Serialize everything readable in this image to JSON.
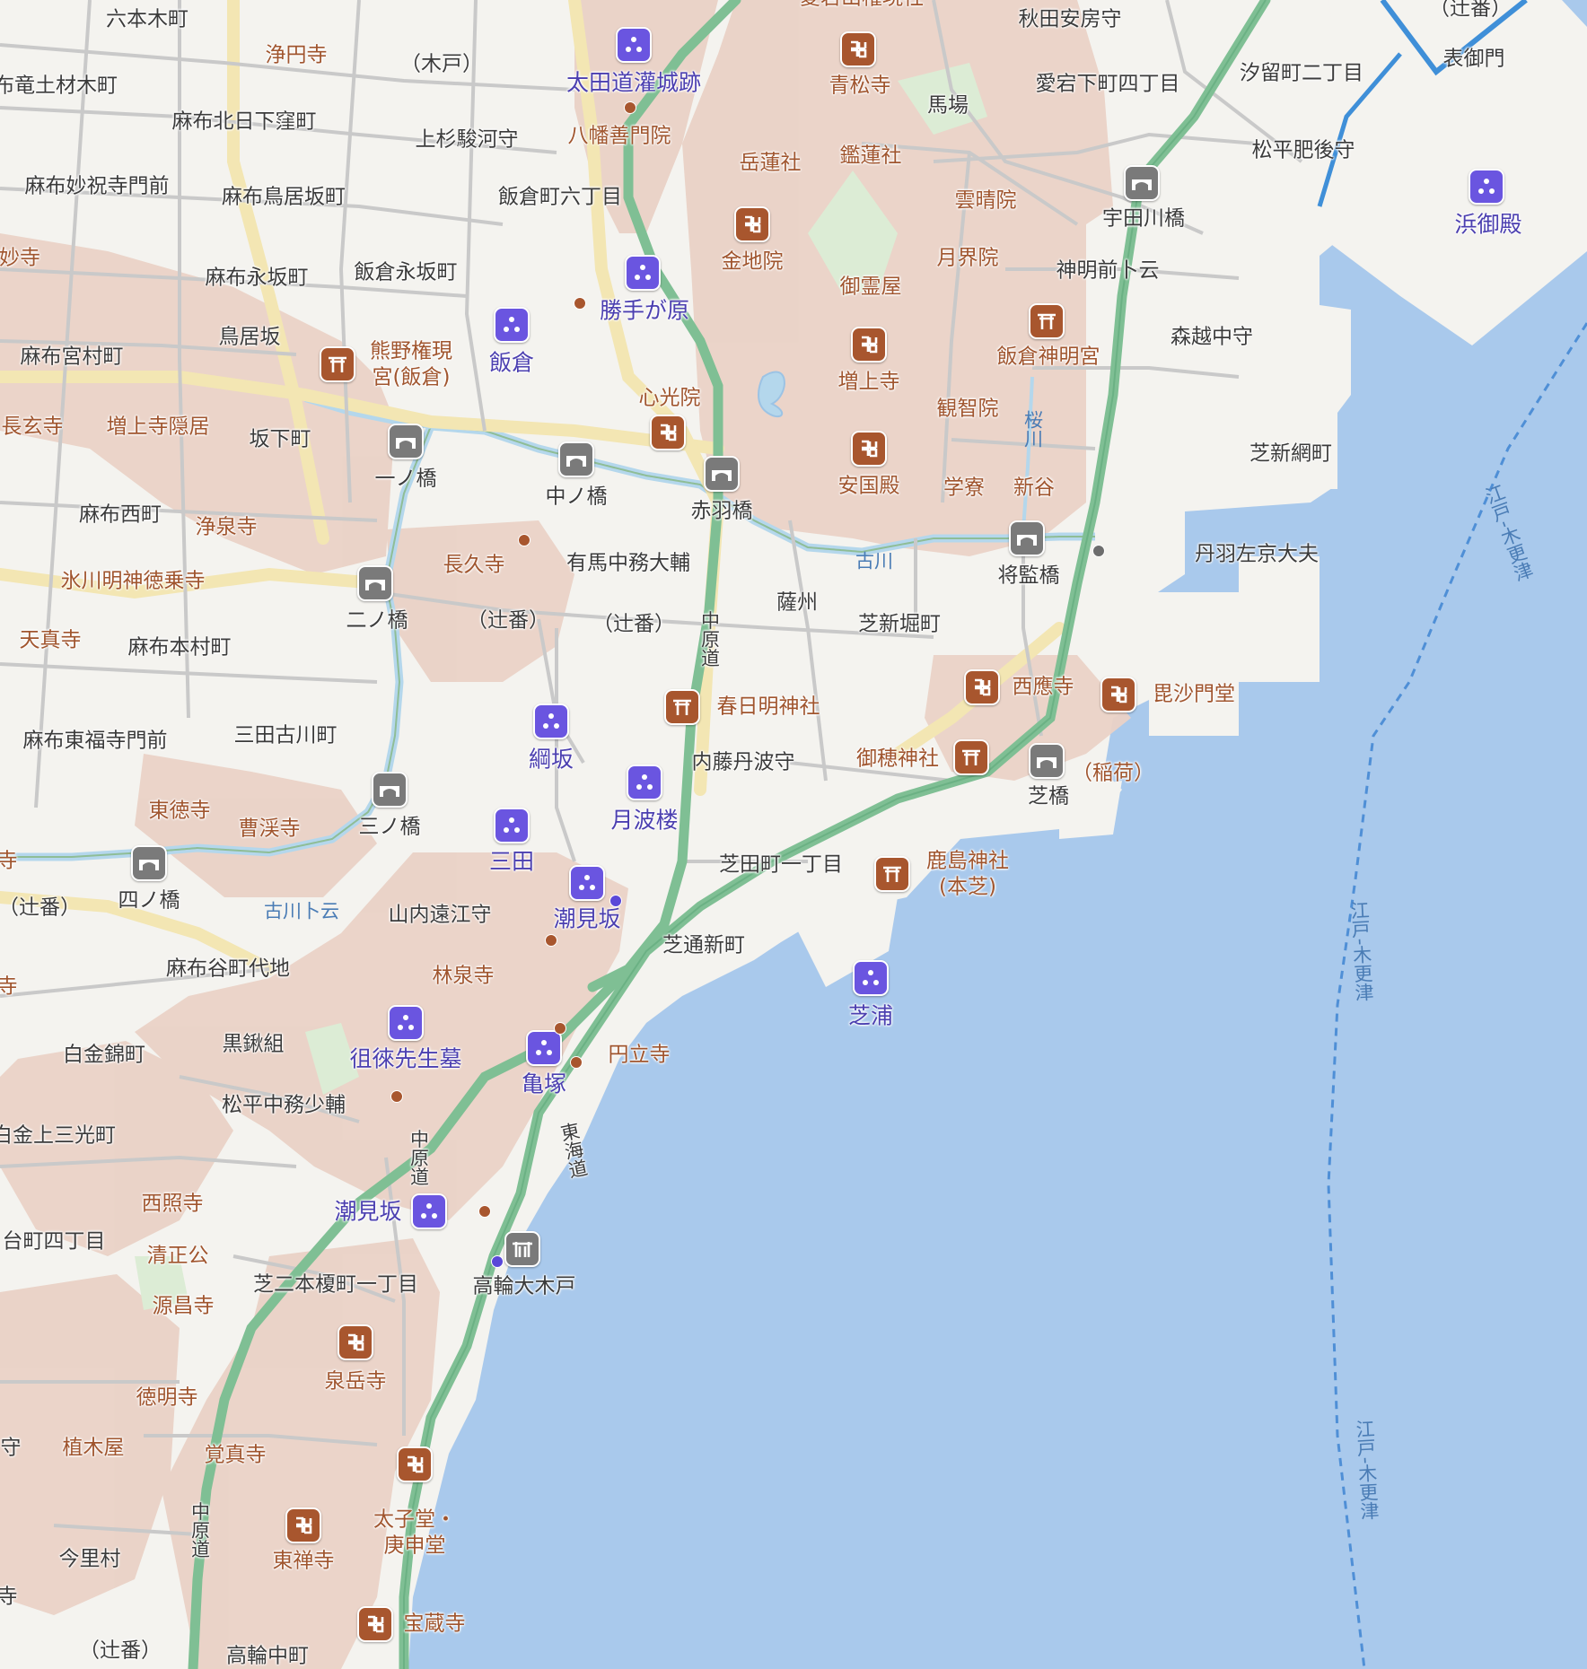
{
  "map": {
    "land_color": "#f4f3ef",
    "water_color": "#a9c9ec",
    "district_color": "#ead2c6",
    "road_color": "#f3e6b3",
    "highway_color": "#7fbf94",
    "river_color": "#b4d7ec",
    "park_color": "#dcecd5"
  },
  "icons": [
    {
      "name": "temple-icon-seishoji",
      "kind": "temple"
    },
    {
      "name": "spot-icon-ota-dokan",
      "kind": "spot"
    },
    {
      "name": "temple-icon-konchiin",
      "kind": "temple"
    },
    {
      "name": "spot-icon-katte",
      "kind": "spot"
    },
    {
      "name": "spot-icon-iikura",
      "kind": "spot"
    },
    {
      "name": "shrine-icon-kumano",
      "kind": "shrine"
    },
    {
      "name": "temple-icon-shinkoin",
      "kind": "temple"
    },
    {
      "name": "temple-icon-zojoji",
      "kind": "temple"
    },
    {
      "name": "temple-icon-ankokuden",
      "kind": "temple"
    },
    {
      "name": "shrine-icon-iikura-shinmei",
      "kind": "shrine"
    },
    {
      "name": "bridge-icon-udagawa",
      "kind": "bridge"
    },
    {
      "name": "spot-icon-hamagoten",
      "kind": "spot"
    },
    {
      "name": "bridge-icon-ichinohashi",
      "kind": "bridge"
    },
    {
      "name": "bridge-icon-nakanohashi",
      "kind": "bridge"
    },
    {
      "name": "bridge-icon-akabane",
      "kind": "bridge"
    },
    {
      "name": "bridge-icon-shokan",
      "kind": "bridge"
    },
    {
      "name": "bridge-icon-ninohashi",
      "kind": "bridge"
    },
    {
      "name": "shrine-icon-kasuga",
      "kind": "shrine"
    },
    {
      "name": "temple-icon-saioji",
      "kind": "temple"
    },
    {
      "name": "temple-icon-bishamon",
      "kind": "temple"
    },
    {
      "name": "spot-icon-tsunazaka",
      "kind": "spot"
    },
    {
      "name": "spot-icon-tsukinami",
      "kind": "spot"
    },
    {
      "name": "shrine-icon-mihoshi",
      "kind": "shrine"
    },
    {
      "name": "bridge-icon-shibahashi",
      "kind": "bridge"
    },
    {
      "name": "bridge-icon-sannohashi",
      "kind": "bridge"
    },
    {
      "name": "spot-icon-mita",
      "kind": "spot"
    },
    {
      "name": "bridge-icon-yonnohashi",
      "kind": "bridge"
    },
    {
      "name": "spot-icon-shiomizaka",
      "kind": "spot"
    },
    {
      "name": "shrine-icon-kashima",
      "kind": "shrine"
    },
    {
      "name": "spot-icon-shibaura",
      "kind": "spot"
    },
    {
      "name": "spot-icon-sorai",
      "kind": "spot"
    },
    {
      "name": "spot-icon-kamezuka",
      "kind": "spot"
    },
    {
      "name": "spot-icon-shiomizaka2",
      "kind": "spot"
    },
    {
      "name": "gate-icon-takanawa",
      "kind": "gate"
    },
    {
      "name": "temple-icon-sengakuji",
      "kind": "temple"
    },
    {
      "name": "temple-icon-taishido",
      "kind": "temple"
    },
    {
      "name": "temple-icon-tozenji",
      "kind": "temple"
    },
    {
      "name": "temple-icon-hozoji",
      "kind": "temple"
    }
  ],
  "labels": {
    "roppongi": "六本木町",
    "joenji": "浄円寺",
    "kido": "（木戸）",
    "ota_dokan": "太田道灌城跡",
    "seishoji": "青松寺",
    "akita": "秋田安房守",
    "tsujiban_top": "（辻番）",
    "omotegomon": "表御門",
    "ryudo": "布竜土材木町",
    "hachiman": "八幡善門院",
    "atago": "愛宕下町四丁目",
    "shiodome": "汐留町二丁目",
    "babamachi": "馬場",
    "kitahigakubo": "麻布北日下窪町",
    "uesugi": "上杉駿河守",
    "matsudaira_higo": "松平肥後守",
    "hamagoten": "浜御殿",
    "myoshuji": "麻布妙祝寺門前",
    "torizaka_machi": "麻布鳥居坂町",
    "iikura6": "飯倉町六丁目",
    "gakurensha": "岳蓮社",
    "kanrensha": "鑑蓮社",
    "unseiin": "雲晴院",
    "udagawa": "宇田川橋",
    "myoji": "妙寺",
    "konchiin": "金地院",
    "gekkaiin": "月界院",
    "shinmeimae": "神明前卜云",
    "nagasaka": "麻布永坂町",
    "iikura_nagasaka": "飯倉永坂町",
    "katte": "勝手が原",
    "goreiya": "御霊屋",
    "torizaka": "鳥居坂",
    "iikura": "飯倉",
    "kumano": "熊野権現\n宮(飯倉)",
    "zojoji": "増上寺",
    "iikura_shinmei": "飯倉神明宮",
    "morikoshi": "森越中守",
    "miyamura": "麻布宮村町",
    "shinkoin": "心光院",
    "kanchiin": "観智院",
    "chogenji": "長玄寺",
    "zojoji_inkyo": "増上寺隠居",
    "sakashita": "坂下町",
    "shibashinami": "芝新網町",
    "ichinohashi": "一ノ橋",
    "nakanohashi": "中ノ橋",
    "akabanebashi": "赤羽橋",
    "ankokuden": "安国殿",
    "gakuryo": "学寮",
    "shintani": "新谷",
    "nishimachi": "麻布西町",
    "josenji": "浄泉寺",
    "niwa": "丹羽左京大夫",
    "shokanbashi": "将監橋",
    "chokyuji": "長久寺",
    "arima": "有馬中務大輔",
    "hikawa": "氷川明神徳乗寺",
    "ninohashi": "二ノ橋",
    "tsujiban1": "（辻番）",
    "tsujiban2": "（辻番）",
    "satsushu": "薩州",
    "shibashinbori": "芝新堀町",
    "tenshinji": "天真寺",
    "honmura": "麻布本村町",
    "kasuga": "春日明神社",
    "saioji": "西應寺",
    "bishamon": "毘沙門堂",
    "tsunazaka": "綱坂",
    "higashifukuji": "麻布東福寺門前",
    "mitafurukawa": "三田古川町",
    "naito": "内藤丹波守",
    "mihoshi": "御穂神社",
    "inari": "（稲荷）",
    "tsukinami": "月波楼",
    "shibahashi": "芝橋",
    "totokuji": "東徳寺",
    "sokeiji": "曹渓寺",
    "sannohashi": "三ノ橋",
    "mita": "三田",
    "shibatamachi": "芝田町一丁目",
    "kashima": "鹿島神社\n(本芝)",
    "yonnohashi": "四ノ橋",
    "tsujiban3": "（辻番）",
    "furukawa_to": "古川卜云",
    "shiomizaka": "潮見坂",
    "yamauchi": "山内遠江守",
    "shibadori": "芝通新町",
    "azabutani": "麻布谷町代地",
    "rinsenji": "林泉寺",
    "shibaura": "芝浦",
    "kurokuwa": "黒鍬組",
    "shirokane": "白金錦町",
    "sorai": "徂徠先生墓",
    "kamezuka": "亀塚",
    "enryuji": "円立寺",
    "matsudaira_nakatsu": "松平中務少輔",
    "shirokane_sanko": "白金上三光町",
    "saishoji": "西照寺",
    "shiomizaka2": "潮見坂",
    "daimachi": "台町四丁目",
    "seishoko": "清正公",
    "takanawa": "高輪大木戸",
    "genshoji": "源昌寺",
    "shiba_nihon": "芝二本榎町一丁目",
    "sengakuji": "泉岳寺",
    "tokumyoji": "徳明寺",
    "ueki": "植木屋",
    "kakushinji": "覚真寺",
    "mamori": "守",
    "taishido": "太子堂・\n庚申堂",
    "tozenji": "東禅寺",
    "imazato": "今里村",
    "hozoji": "宝蔵寺",
    "tsujiban4": "（辻番）",
    "takanawa_naka": "高輪中町",
    "ji1": "寺",
    "ji2": "寺",
    "ji3": "寺",
    "sakura_kawa": "桜川",
    "furukawa": "古川",
    "nakahara1": "中原道",
    "nakahara2": "中原道",
    "nakahara3": "中原道",
    "tokaido": "東海道",
    "edo_kisarazu1": "江戸-木更津",
    "edo_kisarazu2": "江戸-木更津",
    "edo_kisarazu3": "江戸-木更津",
    "top_cut": "愛宕山権現社"
  }
}
